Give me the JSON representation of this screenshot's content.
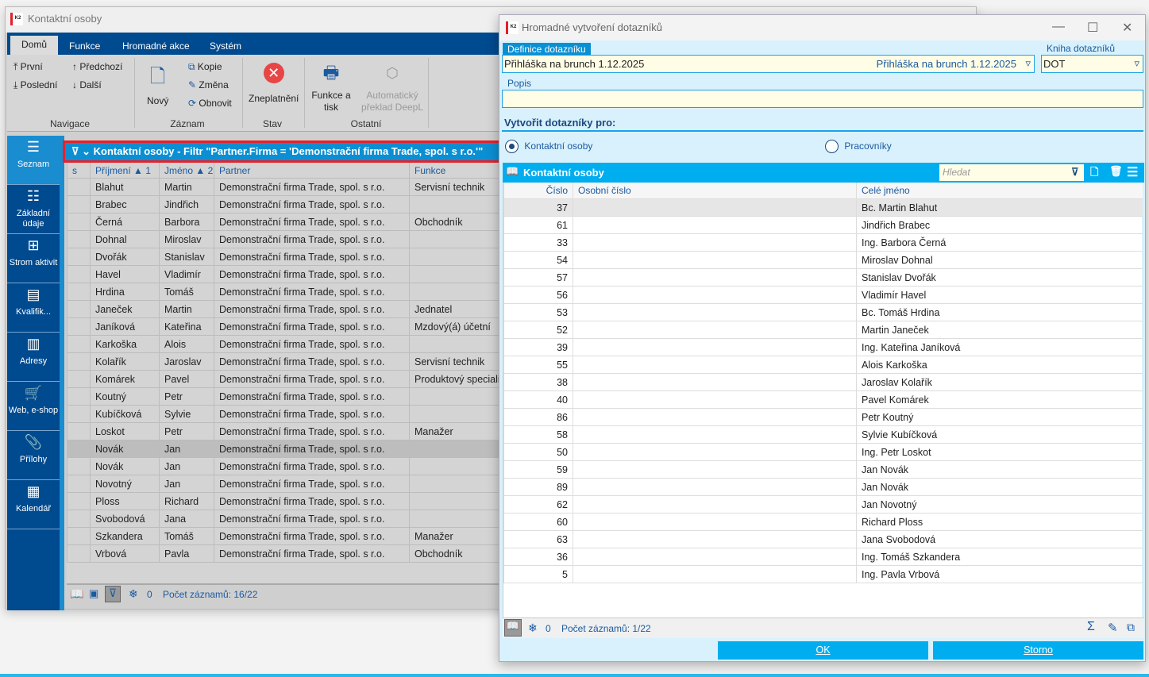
{
  "main_window": {
    "title": "Kontaktní osoby",
    "ribbon_tabs": [
      "Domů",
      "Funkce",
      "Hromadné akce",
      "Systém"
    ],
    "ribbon": {
      "first": "První",
      "prev": "Předchozí",
      "last": "Poslední",
      "next": "Další",
      "new": "Nový",
      "copy": "Kopie",
      "change": "Změna",
      "refresh": "Obnovit",
      "invalidate": "Zneplatnění",
      "print": "Funkce a tisk",
      "translate": "Automatický překlad DeepL",
      "groups": [
        "Navigace",
        "Záznam",
        "Stav",
        "Ostatní"
      ]
    },
    "sidebar": [
      {
        "label": "Seznam",
        "icon": "menu-icon"
      },
      {
        "label": "Základní údaje",
        "icon": "list-icon"
      },
      {
        "label": "Strom aktivit",
        "icon": "tree-icon"
      },
      {
        "label": "Kvalifik...",
        "icon": "certificate-icon"
      },
      {
        "label": "Adresy",
        "icon": "building-icon"
      },
      {
        "label": "Web, e-shop",
        "icon": "cart-icon"
      },
      {
        "label": "Přílohy",
        "icon": "paperclip-icon"
      },
      {
        "label": "Kalendář",
        "icon": "calendar-icon"
      }
    ],
    "filter_title": "Kontaktní osoby - Filtr \"Partner.Firma = 'Demonstrační firma Trade, spol. s r.o.'\"",
    "columns": [
      "s",
      "Příjmení ▲ 1",
      "Jméno ▲ 2",
      "Partner",
      "Funkce"
    ],
    "rows": [
      [
        "Blahut",
        "Martin",
        "Demonstrační firma Trade, spol. s r.o.",
        "Servisní technik"
      ],
      [
        "Brabec",
        "Jindřich",
        "Demonstrační firma Trade, spol. s r.o.",
        ""
      ],
      [
        "Černá",
        "Barbora",
        "Demonstrační firma Trade, spol. s r.o.",
        "Obchodník"
      ],
      [
        "Dohnal",
        "Miroslav",
        "Demonstrační firma Trade, spol. s r.o.",
        ""
      ],
      [
        "Dvořák",
        "Stanislav",
        "Demonstrační firma Trade, spol. s r.o.",
        ""
      ],
      [
        "Havel",
        "Vladimír",
        "Demonstrační firma Trade, spol. s r.o.",
        ""
      ],
      [
        "Hrdina",
        "Tomáš",
        "Demonstrační firma Trade, spol. s r.o.",
        ""
      ],
      [
        "Janeček",
        "Martin",
        "Demonstrační firma Trade, spol. s r.o.",
        "Jednatel"
      ],
      [
        "Janíková",
        "Kateřina",
        "Demonstrační firma Trade, spol. s r.o.",
        "Mzdový(á) účetní"
      ],
      [
        "Karkoška",
        "Alois",
        "Demonstrační firma Trade, spol. s r.o.",
        ""
      ],
      [
        "Kolařík",
        "Jaroslav",
        "Demonstrační firma Trade, spol. s r.o.",
        "Servisní technik"
      ],
      [
        "Komárek",
        "Pavel",
        "Demonstrační firma Trade, spol. s r.o.",
        "Produktový speciali"
      ],
      [
        "Koutný",
        "Petr",
        "Demonstrační firma Trade, spol. s r.o.",
        ""
      ],
      [
        "Kubíčková",
        "Sylvie",
        "Demonstrační firma Trade, spol. s r.o.",
        ""
      ],
      [
        "Loskot",
        "Petr",
        "Demonstrační firma Trade, spol. s r.o.",
        "Manažer"
      ],
      [
        "Novák",
        "Jan",
        "Demonstrační firma Trade, spol. s r.o.",
        ""
      ],
      [
        "Novák",
        "Jan",
        "Demonstrační firma Trade, spol. s r.o.",
        ""
      ],
      [
        "Novotný",
        "Jan",
        "Demonstrační firma Trade, spol. s r.o.",
        ""
      ],
      [
        "Ploss",
        "Richard",
        "Demonstrační firma Trade, spol. s r.o.",
        ""
      ],
      [
        "Svobodová",
        "Jana",
        "Demonstrační firma Trade, spol. s r.o.",
        ""
      ],
      [
        "Szkandera",
        "Tomáš",
        "Demonstrační firma Trade, spol. s r.o.",
        "Manažer"
      ],
      [
        "Vrbová",
        "Pavla",
        "Demonstrační firma Trade, spol. s r.o.",
        "Obchodník"
      ]
    ],
    "selected_row": 15,
    "footer": {
      "count_zero": "0",
      "records": "Počet záznamů: 16/22"
    }
  },
  "dialog": {
    "title": "Hromadné vytvoření dotazníků",
    "def_label": "Definice dotazníku",
    "def_value": "Přihláška na brunch 1.12.2025",
    "def_value_right": "Přihláška na brunch 1.12.2025",
    "book_label": "Kniha dotazníků",
    "book_value": "DOT",
    "popis_label": "Popis",
    "popis_value": "",
    "create_for": "Vytvořit dotazníky pro:",
    "radio_contacts": "Kontaktní osoby",
    "radio_workers": "Pracovníky",
    "radio_selected": "contacts",
    "grid_title": "Kontaktní osoby",
    "search_placeholder": "Hledat",
    "columns": [
      "Číslo",
      "Osobní číslo",
      "Celé jméno"
    ],
    "rows": [
      [
        "37",
        "",
        "Bc. Martin Blahut"
      ],
      [
        "61",
        "",
        "Jindřich Brabec"
      ],
      [
        "33",
        "",
        "Ing. Barbora Černá"
      ],
      [
        "54",
        "",
        "Miroslav Dohnal"
      ],
      [
        "57",
        "",
        "Stanislav Dvořák"
      ],
      [
        "56",
        "",
        "Vladimír Havel"
      ],
      [
        "53",
        "",
        "Bc. Tomáš Hrdina"
      ],
      [
        "52",
        "",
        "Martin Janeček"
      ],
      [
        "39",
        "",
        "Ing. Kateřina Janíková"
      ],
      [
        "55",
        "",
        "Alois Karkoška"
      ],
      [
        "38",
        "",
        "Jaroslav Kolařík"
      ],
      [
        "40",
        "",
        "Pavel Komárek"
      ],
      [
        "86",
        "",
        "Petr Koutný"
      ],
      [
        "58",
        "",
        "Sylvie Kubíčková"
      ],
      [
        "50",
        "",
        "Ing. Petr Loskot"
      ],
      [
        "59",
        "",
        "Jan Novák"
      ],
      [
        "89",
        "",
        "Jan Novák"
      ],
      [
        "62",
        "",
        "Jan Novotný"
      ],
      [
        "60",
        "",
        "Richard Ploss"
      ],
      [
        "63",
        "",
        "Jana Svobodová"
      ],
      [
        "36",
        "",
        "Ing. Tomáš Szkandera"
      ],
      [
        "5",
        "",
        "Ing. Pavla Vrbová"
      ]
    ],
    "footer": {
      "count_zero": "0",
      "records": "Počet záznamů: 1/22"
    },
    "ok": "OK",
    "cancel": "Storno"
  },
  "colors": {
    "ribbon_blue": "#004a8f",
    "accent": "#00adef",
    "highlight_border": "#e8202a",
    "dialog_bg": "#d9f1fc"
  }
}
